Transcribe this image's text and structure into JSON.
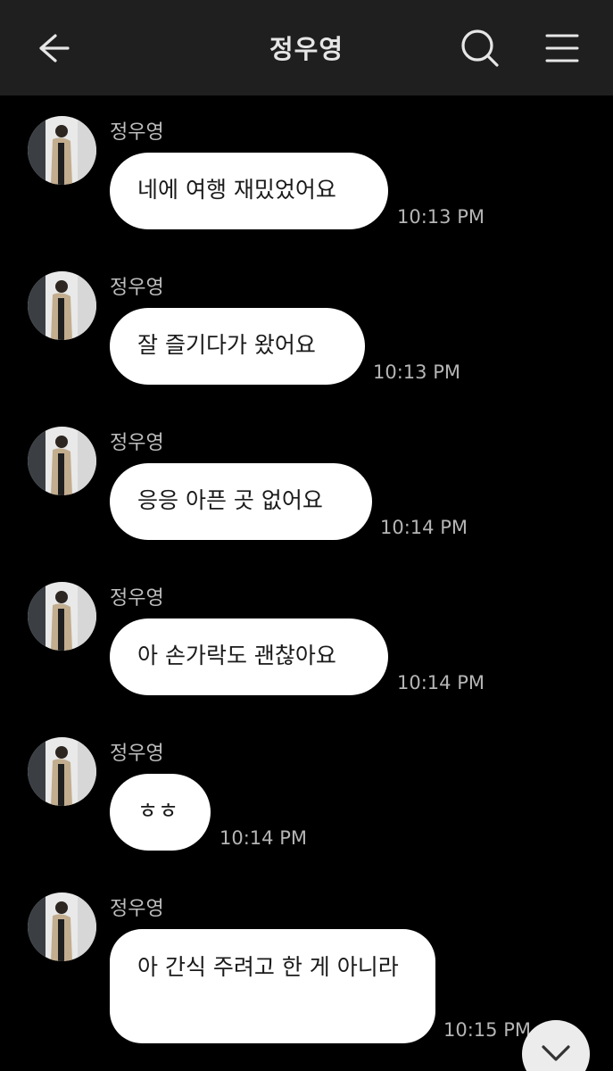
{
  "header": {
    "title": "정우영",
    "back_icon": "arrow-left-icon",
    "search_icon": "search-icon",
    "menu_icon": "hamburger-menu-icon"
  },
  "messages": [
    {
      "sender": "정우영",
      "text": "네에 여행 재밌었어요",
      "time": "10:13 PM"
    },
    {
      "sender": "정우영",
      "text": "잘 즐기다가 왔어요",
      "time": "10:13 PM"
    },
    {
      "sender": "정우영",
      "text": "응응 아픈 곳 없어요",
      "time": "10:14 PM"
    },
    {
      "sender": "정우영",
      "text": "아 손가락도 괜찮아요",
      "time": "10:14 PM"
    },
    {
      "sender": "정우영",
      "text": "ㅎㅎ",
      "time": "10:14 PM"
    },
    {
      "sender": "정우영",
      "text": "아 간식 주려고 한 게 아니라",
      "time": "10:15 PM"
    }
  ],
  "scroll_button": {
    "icon": "chevron-down-icon"
  },
  "colors": {
    "background": "#000000",
    "header": "#1f1f1f",
    "bubble": "#ffffff",
    "time": "#b5b5b5"
  }
}
